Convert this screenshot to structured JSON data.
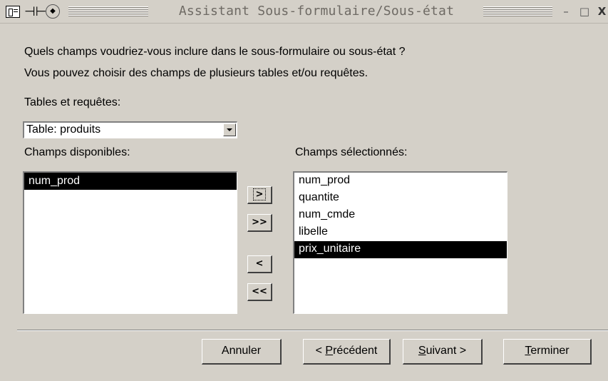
{
  "window": {
    "title": "Assistant Sous-formulaire/Sous-état",
    "icons": [
      "app-icon",
      "pin-icon",
      "sort-icon"
    ],
    "controls": {
      "minimize": "–",
      "maximize": "□",
      "close": "X"
    }
  },
  "instructions": {
    "line1": "Quels champs voudriez-vous inclure dans le sous-formulaire ou sous-état ?",
    "line2": "Vous pouvez choisir des champs de plusieurs tables et/ou requêtes."
  },
  "tables": {
    "label": "Tables et requêtes:",
    "selected": "Table: produits"
  },
  "available": {
    "label": "Champs disponibles:",
    "items": [
      "num_prod"
    ],
    "selected_index": 0
  },
  "selected_fields": {
    "label": "Champs sélectionnés:",
    "items": [
      "num_prod",
      "quantite",
      "num_cmde",
      "libelle",
      "prix_unitaire"
    ],
    "selected_index": 4
  },
  "move_buttons": {
    "add_one": ">",
    "add_all": ">>",
    "remove_one": "<",
    "remove_all": "<<"
  },
  "footer": {
    "cancel": "Annuler",
    "previous": {
      "pre": "< ",
      "accel": "P",
      "post": "récédent"
    },
    "next": {
      "pre": "",
      "accel": "S",
      "post": "uivant >"
    },
    "finish": {
      "pre": "",
      "accel": "T",
      "post": "erminer"
    }
  },
  "colors": {
    "dialog_bg": "#d4d0c8",
    "selection_bg": "#000000",
    "title_text": "#6e6a64"
  }
}
